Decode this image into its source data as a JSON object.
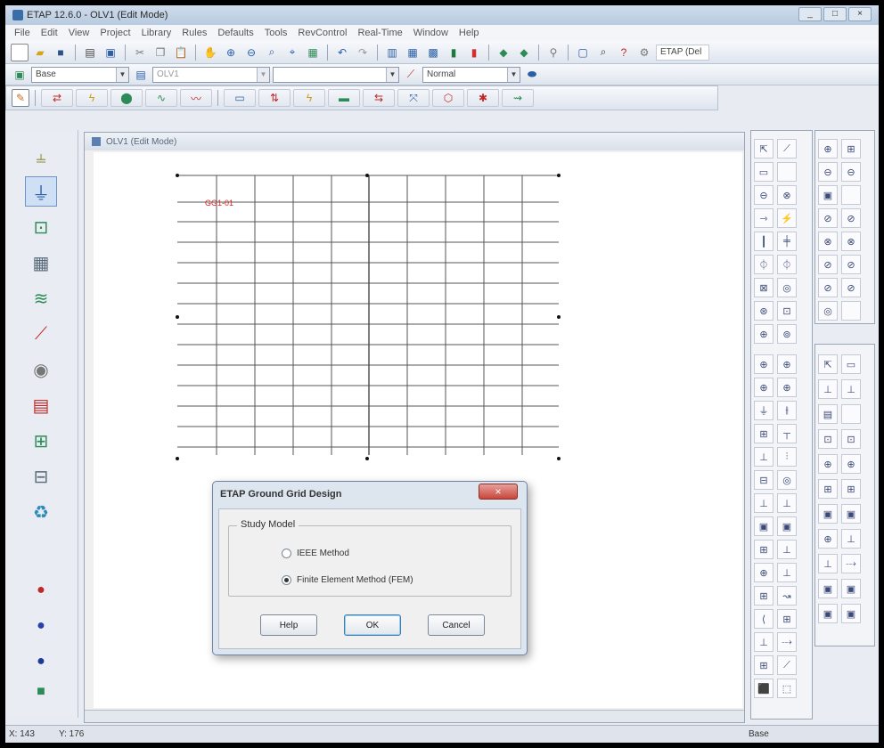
{
  "window": {
    "title": "ETAP 12.6.0 - OLV1 (Edit Mode)",
    "controls": [
      "_",
      "□",
      "×"
    ]
  },
  "menu": [
    "File",
    "Edit",
    "View",
    "Project",
    "Library",
    "Rules",
    "Defaults",
    "Tools",
    "RevControl",
    "Real-Time",
    "Window",
    "Help"
  ],
  "toolbar_row2": {
    "right_label": "ETAP (Del"
  },
  "toolbar_row3": {
    "presentation_combo": "Base",
    "olv_combo": "OLV1",
    "mode_combo": "Normal"
  },
  "document": {
    "title": "OLV1 (Edit Mode)",
    "canvas_label": "GG1-01"
  },
  "dialog": {
    "title": "ETAP Ground Grid Design",
    "close_glyph": "×",
    "group_label": "Study Model",
    "options": [
      {
        "label": "IEEE Method",
        "selected": false
      },
      {
        "label": "Finite Element Method (FEM)",
        "selected": true
      }
    ],
    "buttons": {
      "help": "Help",
      "ok": "OK",
      "cancel": "Cancel"
    }
  },
  "status": {
    "x": "X: 143",
    "y": "Y: 176",
    "presentation": "Base"
  },
  "colors": {
    "canvas_label": "#e02020",
    "grid_line": "#555555",
    "dialog_close": "#c7463b"
  }
}
